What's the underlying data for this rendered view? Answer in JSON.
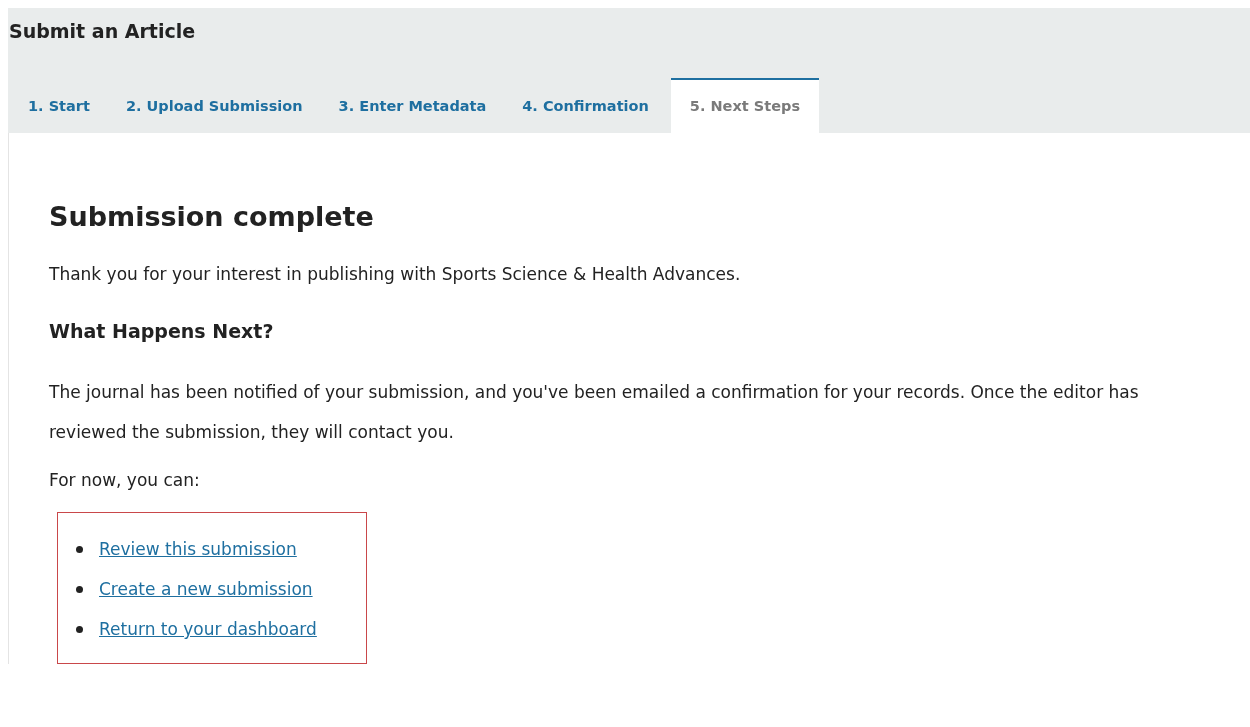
{
  "header": {
    "title": "Submit an Article"
  },
  "tabs": [
    {
      "label": "1. Start",
      "selected": false
    },
    {
      "label": "2. Upload Submission",
      "selected": false
    },
    {
      "label": "3. Enter Metadata",
      "selected": false
    },
    {
      "label": "4. Confirmation",
      "selected": false
    },
    {
      "label": "5. Next Steps",
      "selected": true
    }
  ],
  "content": {
    "heading": "Submission complete",
    "intro": "Thank you for your interest in publishing with Sports Science & Health Advances.",
    "subheading": "What Happens Next?",
    "body": "The journal has been notified of your submission, and you've been emailed a confirmation for your records. Once the editor has reviewed the submission, they will contact you.",
    "lead": "For now, you can:",
    "links": [
      {
        "label": "Review this submission"
      },
      {
        "label": "Create a new submission"
      },
      {
        "label": "Return to your dashboard"
      }
    ]
  }
}
